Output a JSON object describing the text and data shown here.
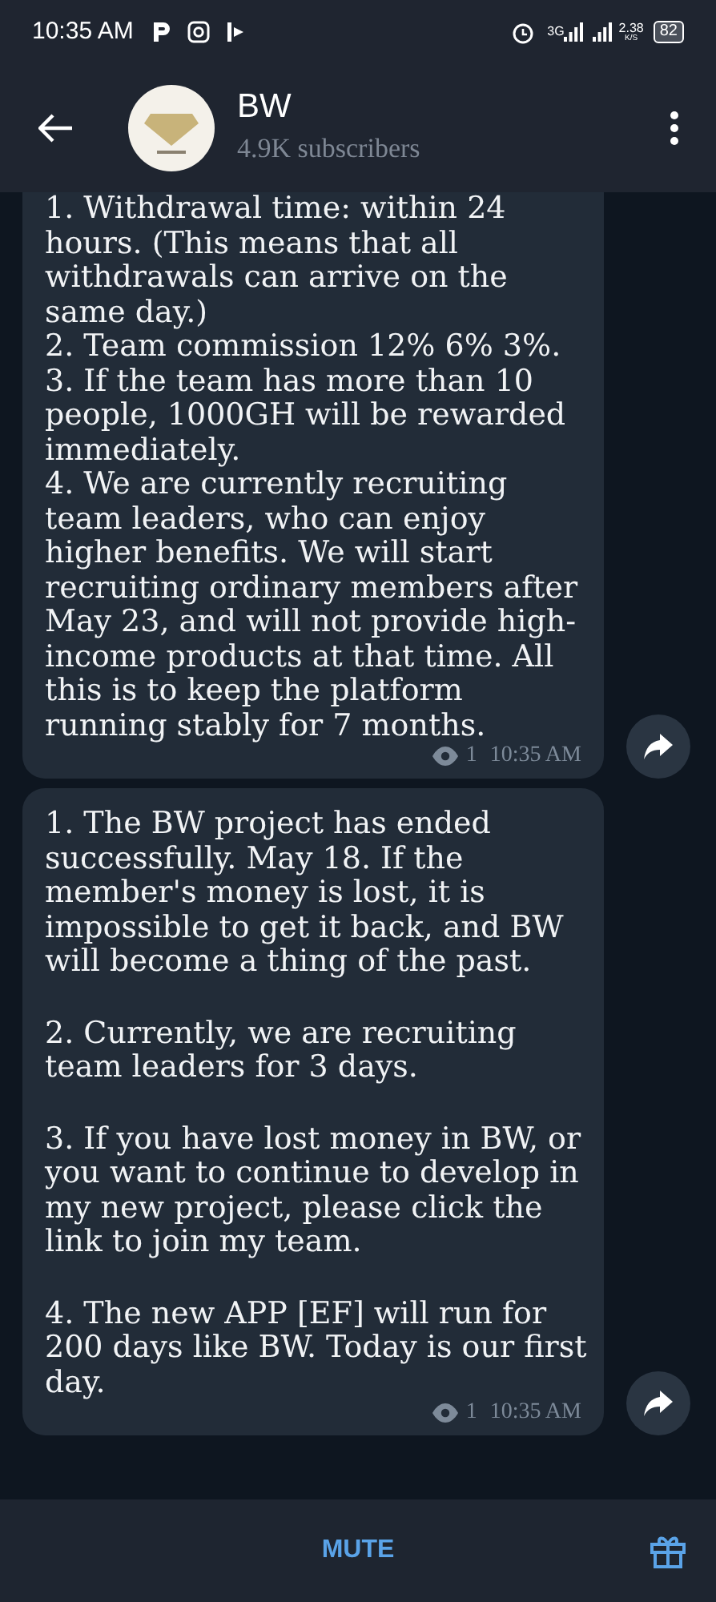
{
  "status_bar": {
    "time": "10:35 AM",
    "network": "3G",
    "speed": "2.38",
    "speed_unit": "K/S",
    "battery": "82"
  },
  "header": {
    "title": "BW",
    "subtitle": "4.9K subscribers"
  },
  "messages": [
    {
      "kind": "compact",
      "paragraphs": [
        "1. Withdrawal time: within 24 hours. (This means that all withdrawals can arrive on the same day.)",
        "2. Team commission 12% 6% 3%.",
        "3. If the team has more than 10 people, 1000GH will be rewarded immediately.",
        "4. We are currently recruiting team leaders, who can enjoy higher benefits. We will start recruiting ordinary members after May 23, and will not provide high-income products at that time. All this is to keep the platform running stably for 7 months."
      ],
      "views": "1",
      "time": "10:35 AM"
    },
    {
      "kind": "spaced",
      "paragraphs": [
        "1. The BW project has ended successfully. May 18. If the member's money is lost, it is impossible to get it back, and BW will become a thing of the past.",
        "2. Currently, we are recruiting team leaders for 3 days.",
        "3. If you have lost money in BW, or you want to continue to develop in my new project, please click the link to join my team.",
        "4. The new APP [EF] will run for 200 days like BW. Today is our first day."
      ],
      "views": "1",
      "time": "10:35 AM"
    }
  ],
  "bottom_bar": {
    "action": "MUTE"
  }
}
